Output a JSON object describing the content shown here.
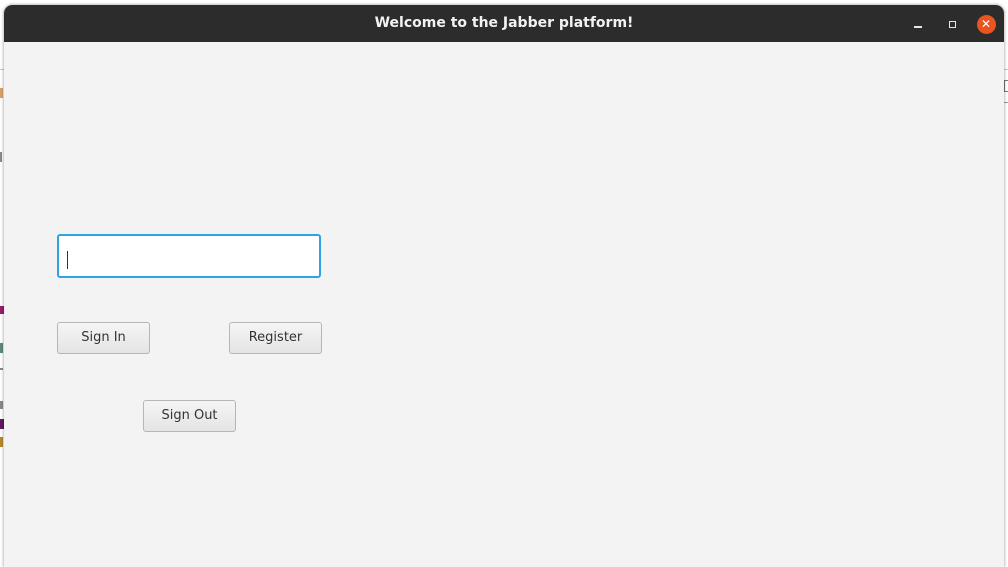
{
  "window": {
    "title": "Welcome to the Jabber platform!"
  },
  "form": {
    "username_value": "",
    "sign_in_label": "Sign In",
    "register_label": "Register",
    "sign_out_label": "Sign Out"
  },
  "colors": {
    "titlebar": "#2c2c2c",
    "close_button": "#e95420",
    "focus_border": "#2fa3e6",
    "window_bg": "#f3f3f3"
  },
  "icons": [
    "minimize-icon",
    "maximize-icon",
    "close-icon"
  ]
}
